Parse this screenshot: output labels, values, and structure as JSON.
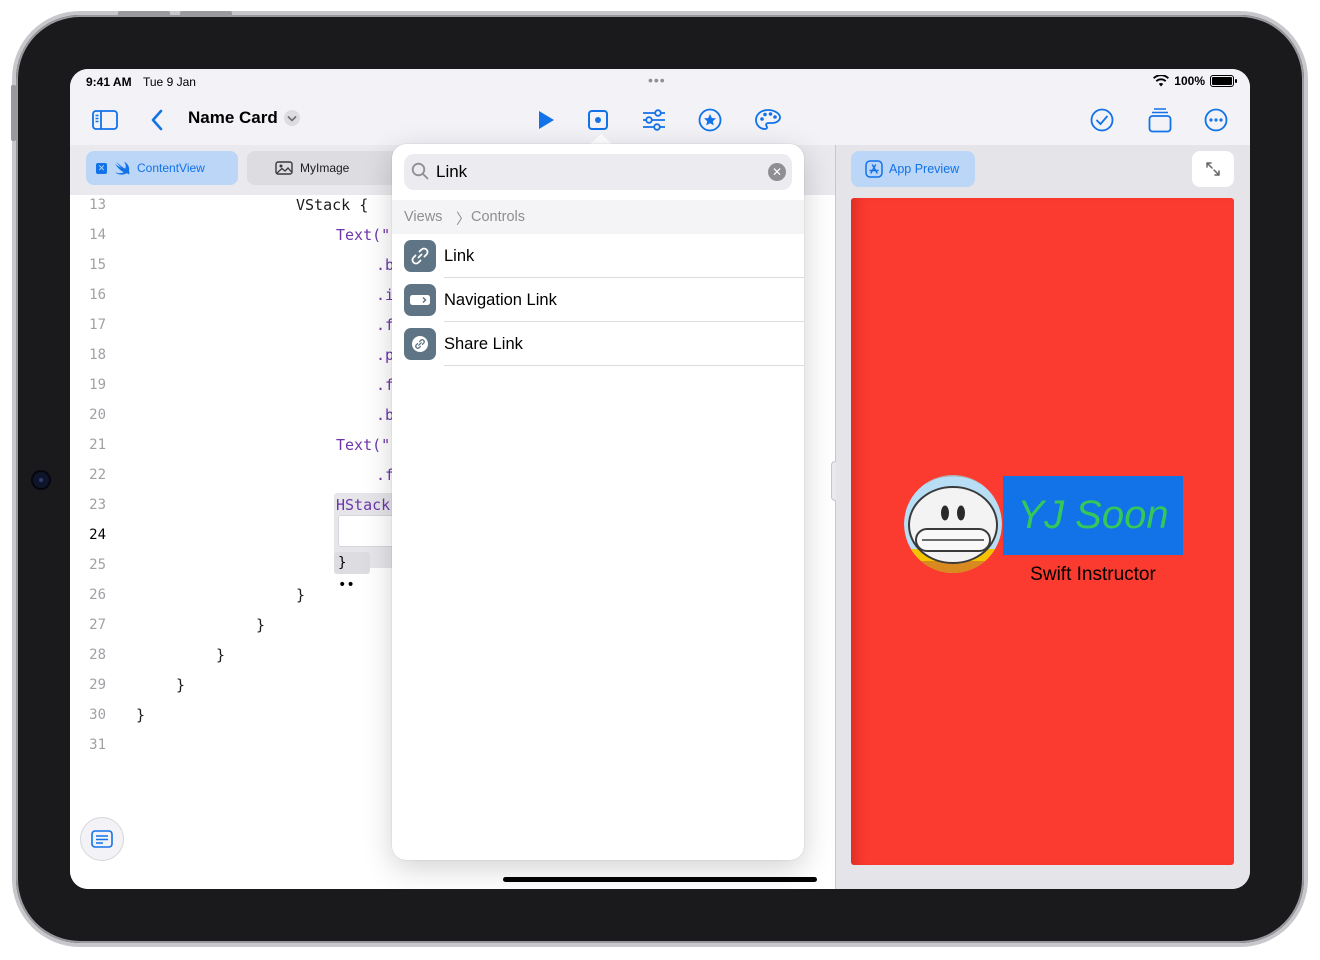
{
  "status": {
    "time": "9:41 AM",
    "date": "Tue 9 Jan",
    "battery": "100%"
  },
  "toolbar": {
    "title": "Name Card",
    "icons": [
      "sidebar-icon",
      "back-chevron-icon",
      "run-icon",
      "record-icon",
      "sliders-icon",
      "star-icon",
      "palette-icon",
      "checkmark-icon",
      "copy-stack-icon",
      "more-icon"
    ]
  },
  "tabs": [
    {
      "label": "ContentView",
      "active": true,
      "icon": "swift-icon"
    },
    {
      "label": "MyImage",
      "active": false,
      "icon": "photo-icon"
    }
  ],
  "editor": {
    "lines": [
      {
        "num": "13",
        "text": "VStack {"
      },
      {
        "num": "14",
        "text": "Text(\""
      },
      {
        "num": "15",
        "text": ".b"
      },
      {
        "num": "16",
        "text": ".i"
      },
      {
        "num": "17",
        "text": ".f"
      },
      {
        "num": "18",
        "text": ".p"
      },
      {
        "num": "19",
        "text": ".f"
      },
      {
        "num": "20",
        "text": ".b"
      },
      {
        "num": "21",
        "text": "Text(\""
      },
      {
        "num": "22",
        "text": ".f"
      },
      {
        "num": "23",
        "text": "HStack"
      },
      {
        "num": "24",
        "text": ""
      },
      {
        "num": "25",
        "text": "}"
      },
      {
        "num": "26",
        "text": "}"
      },
      {
        "num": "27",
        "text": "}"
      },
      {
        "num": "28",
        "text": "}"
      },
      {
        "num": "29",
        "text": "}"
      },
      {
        "num": "30",
        "text": "}"
      },
      {
        "num": "31",
        "text": ""
      }
    ],
    "collapsed_marker": "••"
  },
  "popover": {
    "search_value": "Link",
    "breadcrumb": [
      "Views",
      "Controls"
    ],
    "items": [
      {
        "label": "Link",
        "icon": "link-icon"
      },
      {
        "label": "Navigation Link",
        "icon": "navigation-link-icon"
      },
      {
        "label": "Share Link",
        "icon": "share-link-icon"
      }
    ]
  },
  "preview": {
    "button_label": "App Preview",
    "name": "YJ Soon",
    "subtitle": "Swift Instructor",
    "colors": {
      "background": "#fb3a30",
      "name_box": "#1272e8",
      "name_text": "#34c759"
    }
  }
}
